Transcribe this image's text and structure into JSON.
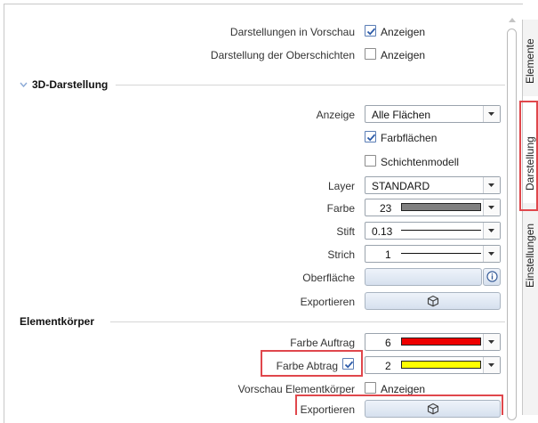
{
  "rows": {
    "vorschau": {
      "label": "Darstellungen in Vorschau",
      "checkbox_label": "Anzeigen",
      "checked": true
    },
    "oberschichten": {
      "label": "Darstellung der Oberschichten",
      "checkbox_label": "Anzeigen",
      "checked": false
    }
  },
  "section_3d": {
    "title": "3D-Darstellung",
    "anzeige": {
      "label": "Anzeige",
      "value": "Alle Flächen"
    },
    "farbflaechen": {
      "label": "Farbflächen",
      "checked": true
    },
    "schichtenmodell": {
      "label": "Schichtenmodell",
      "checked": false
    },
    "layer": {
      "label": "Layer",
      "value": "STANDARD"
    },
    "farbe": {
      "label": "Farbe",
      "value": "23",
      "color": "#808080"
    },
    "stift": {
      "label": "Stift",
      "value": "0.13"
    },
    "strich": {
      "label": "Strich",
      "value": "1"
    },
    "oberflaeche": {
      "label": "Oberfläche"
    },
    "exportieren": {
      "label": "Exportieren"
    }
  },
  "section_element": {
    "title": "Elementkörper",
    "farbe_auftrag": {
      "label": "Farbe Auftrag",
      "value": "6",
      "color": "#ee0000"
    },
    "farbe_abtrag": {
      "label": "Farbe Abtrag",
      "checked": true,
      "value": "2",
      "color": "#ffff00"
    },
    "vorschau_elementkoerper": {
      "label": "Vorschau Elementkörper",
      "checkbox_label": "Anzeigen",
      "checked": false
    },
    "exportieren": {
      "label": "Exportieren"
    }
  },
  "side_tabs": [
    {
      "label": "Elemente"
    },
    {
      "label": "Darstellung"
    },
    {
      "label": "Einstellungen"
    }
  ],
  "colors": {
    "highlight": "#e0474c",
    "accent": "#5a7db5"
  }
}
